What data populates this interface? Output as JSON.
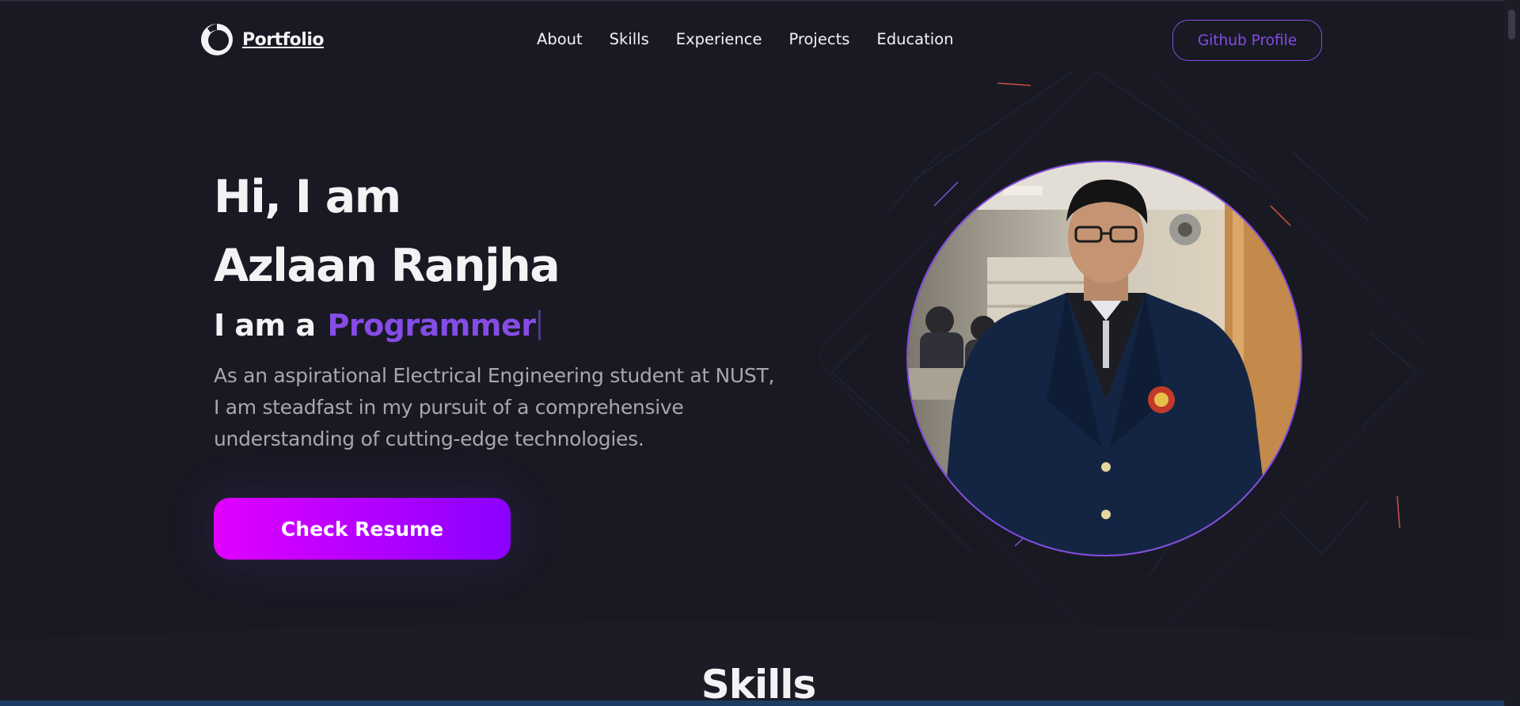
{
  "navbar": {
    "logo_text": "Portfolio",
    "links": [
      "About",
      "Skills",
      "Experience",
      "Projects",
      "Education"
    ],
    "github_label": "Github Profile"
  },
  "hero": {
    "greeting_line1": "Hi, I am",
    "greeting_line2": "Azlaan Ranjha",
    "role_prefix": "I am a",
    "role_word": "Programmer",
    "description": "As an aspirational Electrical Engineering student at NUST, I am steadfast in my pursuit of a comprehensive understanding of cutting-edge technologies.",
    "resume_label": "Check Resume"
  },
  "skills_section": {
    "title": "Skills"
  },
  "colors": {
    "background": "#191924",
    "accent": "#854ce6",
    "text_primary": "#f2f3f4",
    "text_secondary": "#a7a7b1",
    "button_gradient_start": "#e100ff",
    "button_gradient_end": "#8a00ff"
  },
  "icons": {
    "logo": "circle-logo-icon"
  }
}
